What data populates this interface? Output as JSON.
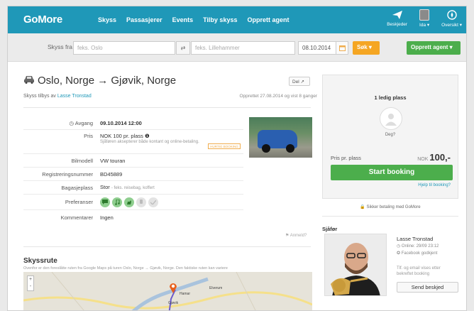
{
  "nav": {
    "logo": "GoMore",
    "links": [
      "Skyss",
      "Passasjerer",
      "Events",
      "Tilby skyss",
      "Opprett agent"
    ],
    "messages_label": "Beskjeder",
    "user_label": "Ida ▾",
    "overview_label": "Oversikt ▾"
  },
  "search": {
    "label": "Skyss fra",
    "from_placeholder": "feks. Oslo",
    "swap_label": "⇄",
    "to_placeholder": "feks. Lillehammer",
    "date_value": "08.10.2014",
    "search_button": "Søk ▾",
    "agent_button": "Opprett agent ▾"
  },
  "trip": {
    "title": "Oslo, Norge → Gjøvik, Norge",
    "share_label": "Del ↗",
    "offered_prefix": "Skyss tilbys av",
    "driver_link": "Lasse Tronstad",
    "created": "Opprettet 27.08.2014 og vist 8 ganger",
    "details": [
      {
        "key": "◷ Avgang",
        "value": "09.10.2014 12:00"
      },
      {
        "key": "Pris",
        "value": "NOK 100 pr. plass ❶",
        "sub": "Sjåføren aksepterer både kontant og online-betaling."
      },
      {
        "key": "Bilmodell",
        "value": "VW touran"
      },
      {
        "key": "Registreringsnummer",
        "value": "BD45889"
      },
      {
        "key": "Bagasjeplass",
        "value": "Stor",
        "sub": "- feks. reisebag, koffert"
      },
      {
        "key": "Preferanser",
        "value": ""
      },
      {
        "key": "Kommentarer",
        "value": "Ingen"
      }
    ],
    "flash_badge": "HURTIG BOOKING",
    "report": "⚑ Anmeld?"
  },
  "route": {
    "heading": "Skyssrute",
    "description": "Ovenfor er den foreslåtte ruten fra Google Maps på turen Oslo, Norge → Gjøvik, Norge. Den faktiske ruten kan variere",
    "map_labels": [
      "Hamar",
      "Elverum",
      "Gjøvik"
    ],
    "zoom": [
      "+",
      "-"
    ]
  },
  "booking": {
    "seats": "1 ledig plass",
    "guest_label": "Deg?",
    "price_label": "Pris pr. plass",
    "price_currency": "NOK",
    "price_value": "100,-",
    "book_button": "Start booking",
    "help_link": "Hjelp til booking?",
    "secure": "🔒 Sikker betaling med GoMore"
  },
  "driver": {
    "heading": "Sjåfør",
    "name": "Lasse Tronstad",
    "online": "◷ Online: 29/09 23:12",
    "facebook": "✪ Facebook godkjent",
    "note": "Tlf. og email vises etter bekreftet booking",
    "message_button": "Send beskjed"
  },
  "colors": {
    "brand": "#1f98b8",
    "green": "#4cae4c",
    "orange": "#f5a623"
  }
}
